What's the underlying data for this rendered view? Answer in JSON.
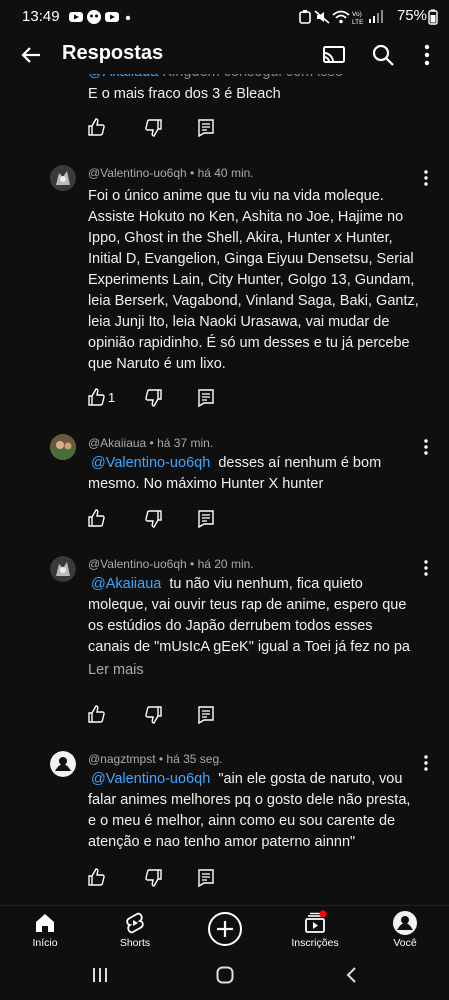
{
  "status_bar": {
    "time": "13:49",
    "battery": "75%"
  },
  "header": {
    "title": "Respostas"
  },
  "partial_comment": {
    "mention": "@Akaiiaua",
    "cut_text": "Kingdom consegui com isso",
    "text": "E o mais fraco dos 3 é Bleach"
  },
  "comments": [
    {
      "author": "@Valentino-uo6qh",
      "time": "há 40 min.",
      "lines": [
        "Foi o único anime que tu viu na vida moleque.",
        "Assiste Hokuto no Ken, Ashita no Joe, Hajime no",
        "Ippo, Ghost in the Shell, Akira, Hunter x Hunter,",
        "Initial D, Evangelion, Ginga Eiyuu Densetsu, Serial",
        "Experiments Lain, City Hunter, Golgo 13, Gundam,",
        "leia Berserk, Vagabond, Vinland Saga, Baki, Gantz,",
        "leia Junji Ito, leia Naoki Urasawa, vai mudar de",
        "opinião rapidinho. É só um desses e tu já percebe",
        "que Naruto é um lixo."
      ],
      "likes": "1"
    },
    {
      "author": "@Akaiiaua",
      "time": "há 37 min.",
      "mention": "@Valentino-uo6qh",
      "first_rest": "  desses aí nenhum é bom",
      "lines": [
        "mesmo. No máximo Hunter X hunter"
      ]
    },
    {
      "author": "@Valentino-uo6qh",
      "time": "há 20 min.",
      "mention": "@Akaiiaua",
      "first_rest": "  tu não viu nenhum, fica quieto",
      "lines": [
        "moleque, vai ouvir teus rap de anime, espero que",
        "os estúdios do Japão derrubem todos esses",
        "canais de \"mUsIcA gEeK\" igual a Toei já fez no pa"
      ],
      "read_more": "Ler mais"
    },
    {
      "author": "@nagztmpst",
      "time": "há 35 seg.",
      "mention": "@Valentino-uo6qh",
      "first_rest": "  \"ain ele gosta de naruto, vou",
      "lines": [
        "falar animes melhores pq o gosto dele não presta,",
        "e o meu é melhor, ainn como eu sou carente de",
        "atenção e nao tenho amor paterno ainnn\""
      ]
    }
  ],
  "nav": {
    "home": "Início",
    "shorts": "Shorts",
    "subscriptions": "Inscrições",
    "you": "Você"
  },
  "colors": {
    "background": "#0f0f0f",
    "mention": "#3ea6ff",
    "notification_dot": "#ff0000"
  }
}
